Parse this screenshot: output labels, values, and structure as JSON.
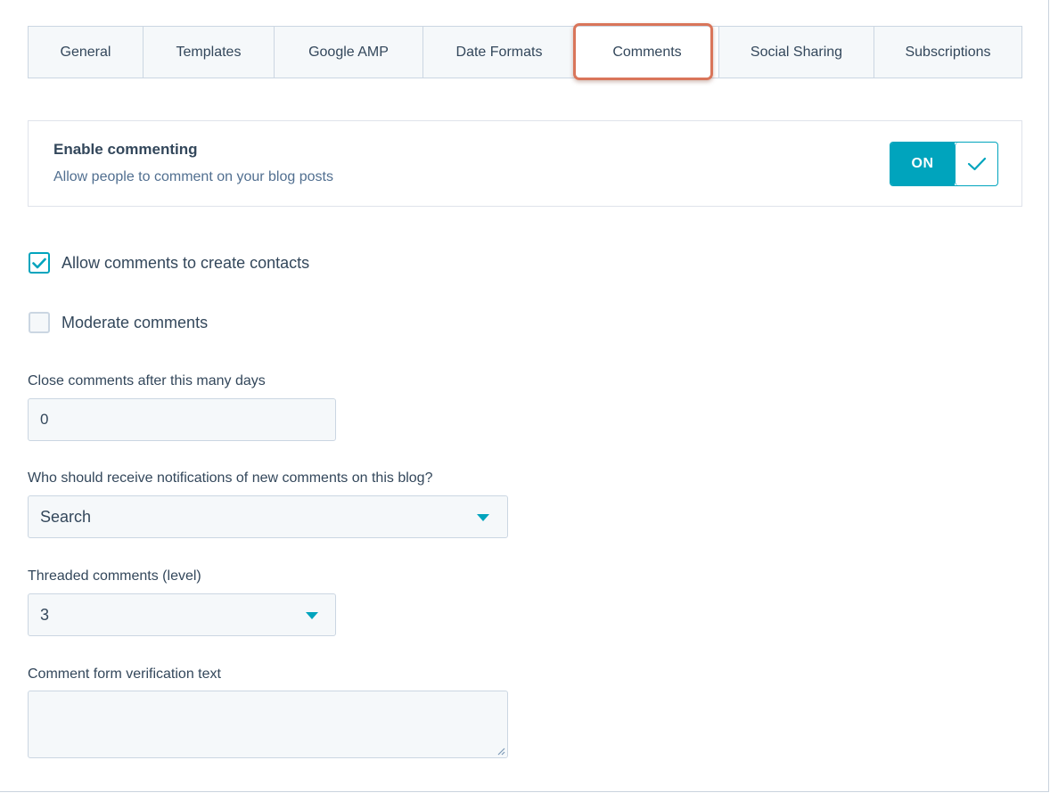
{
  "tabs": [
    {
      "label": "General",
      "active": false
    },
    {
      "label": "Templates",
      "active": false
    },
    {
      "label": "Google AMP",
      "active": false
    },
    {
      "label": "Date Formats",
      "active": false
    },
    {
      "label": "Comments",
      "active": true
    },
    {
      "label": "Social Sharing",
      "active": false
    },
    {
      "label": "Subscriptions",
      "active": false
    }
  ],
  "enable_commenting": {
    "title": "Enable commenting",
    "description": "Allow people to comment on your blog posts",
    "toggle_label": "ON",
    "enabled": true
  },
  "checkboxes": [
    {
      "label": "Allow comments to create contacts",
      "checked": true
    },
    {
      "label": "Moderate comments",
      "checked": false
    }
  ],
  "close_comments": {
    "label": "Close comments after this many days",
    "value": "0"
  },
  "notifications": {
    "label": "Who should receive notifications of new comments on this blog?",
    "placeholder": "Search"
  },
  "threaded": {
    "label": "Threaded comments (level)",
    "value": "3"
  },
  "verification": {
    "label": "Comment form verification text",
    "value": ""
  },
  "colors": {
    "accent": "#00a4bd",
    "highlight": "#d9755a",
    "text": "#33475b",
    "field_bg": "#f5f8fa",
    "border": "#cbd6e2"
  }
}
